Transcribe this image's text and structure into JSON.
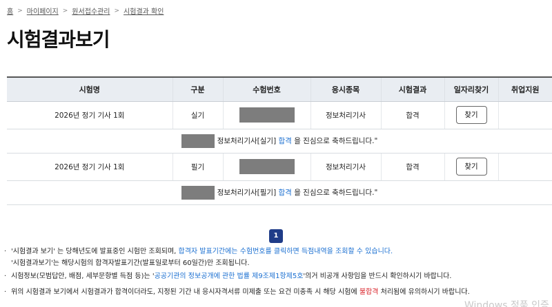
{
  "breadcrumb": {
    "home": "홈",
    "mypage": "마이페이지",
    "apply_manage": "원서접수관리",
    "result_check": "시험결과 확인"
  },
  "page_title": "시험결과보기",
  "table": {
    "headers": [
      "시험명",
      "구분",
      "수험번호",
      "응시종목",
      "시험결과",
      "일자리찾기",
      "취업지원"
    ],
    "rows": [
      {
        "exam_name": "2026년 정기 기사 1회",
        "type": "실기",
        "field": "정보처리기사",
        "result": "합격",
        "find_label": "찾기",
        "msg_before": "정보처리기사[실기]",
        "msg_highlight": "합격",
        "msg_after": "을 진심으로 축하드립니다.\""
      },
      {
        "exam_name": "2026년 정기 기사 1회",
        "type": "필기",
        "field": "정보처리기사",
        "result": "합격",
        "find_label": "찾기",
        "msg_before": "정보처리기사[필기]",
        "msg_highlight": "합격",
        "msg_after": "을 진심으로 축하드립니다.\""
      }
    ]
  },
  "pagination": {
    "current": "1"
  },
  "notes": {
    "n1_a": "'시험결과 보기' 는 당해년도에 발표중인 시험만 조회되며, ",
    "n1_b": "합격자 발표기간에는 수험번호를 클릭하면 득점내역을 조회할 수 있습니다.",
    "n1_c": "'시험결과보기'는 해당시험의 합격자발표기간(발표일로부터 60일간)만 조회됩니다.",
    "n2_a": "시험정보(모범답안, 배점, 세부문항별 득점 등)는 '",
    "n2_b": "공공기관의 정보공개에 관한 법률 제9조제1항제5호",
    "n2_c": "'의거 비공개 사항임을 반드시 확인하시기 바랍니다.",
    "n3_a": "위의 시험결과 보기에서 시험결과가 합격이더라도, 지정된 기간 내 응시자격서류 미제출 또는 요건 미충족 시 해당 시험에 ",
    "n3_b": "불합격",
    "n3_c": " 처리됨에 유의하시기 바랍니다."
  },
  "watermark": "Windows 정품 인증",
  "colors": {
    "accent_blue": "#1a6fd1",
    "accent_red": "#d81f26",
    "pager_bg": "#1f3c88",
    "header_bg": "#e9edf2"
  }
}
